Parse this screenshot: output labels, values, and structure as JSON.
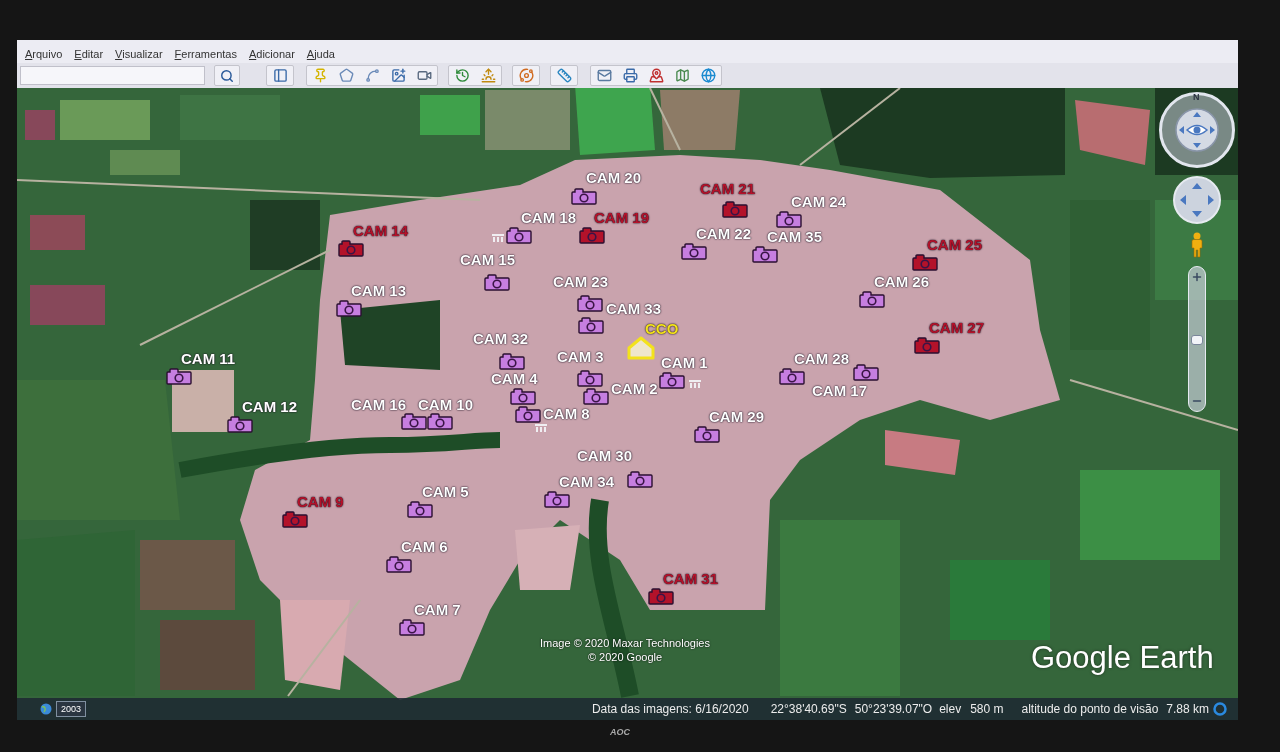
{
  "menu_bar": {
    "items": [
      "Arquivo",
      "Editar",
      "Visualizar",
      "Ferramentas",
      "Adicionar",
      "Ajuda"
    ]
  },
  "map": {
    "markers": [
      {
        "label": "CAM 20",
        "kind": "camera",
        "color": "#c67ee0",
        "highlighted": false
      },
      {
        "label": "CAM 21",
        "kind": "camera",
        "color": "#b3122a",
        "highlighted": true
      },
      {
        "label": "CAM 18",
        "kind": "camera",
        "color": "#c67ee0",
        "highlighted": false
      },
      {
        "label": "CAM 19",
        "kind": "camera",
        "color": "#b3122a",
        "highlighted": true
      },
      {
        "label": "CAM 14",
        "kind": "camera",
        "color": "#b3122a",
        "highlighted": true
      },
      {
        "label": "CAM 24",
        "kind": "camera",
        "color": "#c67ee0",
        "highlighted": false
      },
      {
        "label": "CAM 22",
        "kind": "camera",
        "color": "#c67ee0",
        "highlighted": false
      },
      {
        "label": "CAM 35",
        "kind": "camera",
        "color": "#c67ee0",
        "highlighted": false
      },
      {
        "label": "CAM 25",
        "kind": "camera",
        "color": "#b3122a",
        "highlighted": true
      },
      {
        "label": "CAM 15",
        "kind": "camera",
        "color": "#c67ee0",
        "highlighted": false
      },
      {
        "label": "CAM 23",
        "kind": "camera",
        "color": "#c67ee0",
        "highlighted": false
      },
      {
        "label": "CAM 13",
        "kind": "camera",
        "color": "#c67ee0",
        "highlighted": false
      },
      {
        "label": "CAM 26",
        "kind": "camera",
        "color": "#c67ee0",
        "highlighted": false
      },
      {
        "label": "CAM 33",
        "kind": "camera",
        "color": "#c67ee0",
        "highlighted": false
      },
      {
        "label": "CAM 27",
        "kind": "camera",
        "color": "#b3122a",
        "highlighted": true
      },
      {
        "label": "CCO",
        "kind": "base",
        "color": "#f3e21c",
        "highlighted": true
      },
      {
        "label": "CAM 32",
        "kind": "camera",
        "color": "#c67ee0",
        "highlighted": false
      },
      {
        "label": "CAM 11",
        "kind": "camera",
        "color": "#c67ee0",
        "highlighted": false
      },
      {
        "label": "CAM 3",
        "kind": "camera",
        "color": "#c67ee0",
        "highlighted": false
      },
      {
        "label": "CAM 1",
        "kind": "camera",
        "color": "#c67ee0",
        "highlighted": false
      },
      {
        "label": "CAM 28",
        "kind": "camera",
        "color": "#c67ee0",
        "highlighted": false
      },
      {
        "label": "CAM 17",
        "kind": "camera",
        "color": "#c67ee0",
        "highlighted": false
      },
      {
        "label": "CAM 4",
        "kind": "camera",
        "color": "#c67ee0",
        "highlighted": false
      },
      {
        "label": "CAM 2",
        "kind": "camera",
        "color": "#c67ee0",
        "highlighted": false
      },
      {
        "label": "CAM 8",
        "kind": "camera",
        "color": "#c67ee0",
        "highlighted": false
      },
      {
        "label": "CAM 12",
        "kind": "camera",
        "color": "#c67ee0",
        "highlighted": false
      },
      {
        "label": "CAM 16",
        "kind": "camera",
        "color": "#c67ee0",
        "highlighted": false
      },
      {
        "label": "CAM 10",
        "kind": "camera",
        "color": "#c67ee0",
        "highlighted": false
      },
      {
        "label": "CAM 29",
        "kind": "camera",
        "color": "#c67ee0",
        "highlighted": false
      },
      {
        "label": "CAM 30",
        "kind": "camera",
        "color": "#c67ee0",
        "highlighted": false
      },
      {
        "label": "CAM 34",
        "kind": "camera",
        "color": "#c67ee0",
        "highlighted": false
      },
      {
        "label": "CAM 5",
        "kind": "camera",
        "color": "#c67ee0",
        "highlighted": false
      },
      {
        "label": "CAM 9",
        "kind": "camera",
        "color": "#b3122a",
        "highlighted": true
      },
      {
        "label": "CAM 6",
        "kind": "camera",
        "color": "#c67ee0",
        "highlighted": false
      },
      {
        "label": "CAM 31",
        "kind": "camera",
        "color": "#b3122a",
        "highlighted": true
      },
      {
        "label": "CAM 7",
        "kind": "camera",
        "color": "#c67ee0",
        "highlighted": false
      }
    ],
    "attribution": [
      "Image © 2020 Maxar Technologies",
      "© 2020 Google"
    ],
    "logo": "Google Earth"
  },
  "navigation": {
    "compass_north": "N",
    "zoom": {
      "level": 0.5
    }
  },
  "status_bar": {
    "imagery_year": "2003",
    "imagery_date": "Data das imagens: 6/16/2020",
    "latitude": "22°38'40.69\"S",
    "longitude": "50°23'39.07\"O",
    "elevation_label": "elev",
    "elevation": "580 m",
    "eye_altitude_label": "altitude do ponto de visão",
    "eye_altitude": "7.88 km"
  },
  "monitor": {
    "logo": "AOC"
  }
}
